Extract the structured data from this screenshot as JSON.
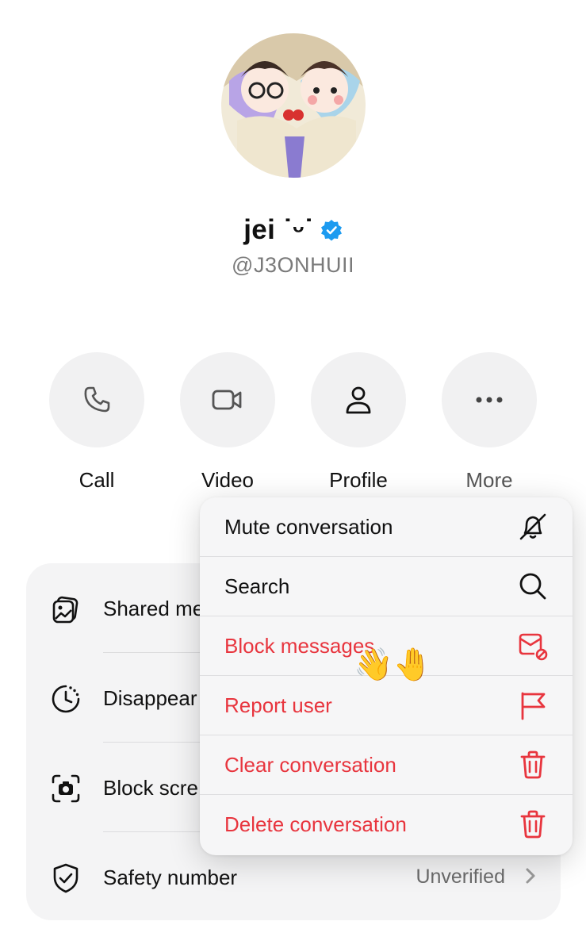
{
  "profile": {
    "display_name": "jei ˙ᵕ˙",
    "handle": "@J3ONHUII"
  },
  "actions": [
    {
      "label": "Call",
      "icon": "phone-icon"
    },
    {
      "label": "Video",
      "icon": "video-camera-icon"
    },
    {
      "label": "Profile",
      "icon": "person-icon"
    },
    {
      "label": "More",
      "icon": "more-dots-icon"
    }
  ],
  "settings": [
    {
      "label": "Shared me",
      "icon": "photos-icon"
    },
    {
      "label": "Disappear",
      "icon": "timer-icon"
    },
    {
      "label": "Block scre",
      "icon": "screenshot-camera-icon"
    },
    {
      "label": "Safety number",
      "icon": "shield-check-icon",
      "value": "Unverified"
    }
  ],
  "menu": [
    {
      "label": "Mute conversation",
      "icon": "bell-slash-icon",
      "danger": false
    },
    {
      "label": "Search",
      "icon": "search-icon",
      "danger": false
    },
    {
      "label": "Block messages",
      "icon": "envelope-block-icon",
      "danger": true
    },
    {
      "label": "Report user",
      "icon": "flag-icon",
      "danger": true
    },
    {
      "label": "Clear conversation",
      "icon": "trash-icon",
      "danger": true
    },
    {
      "label": "Delete conversation",
      "icon": "trash-icon",
      "danger": true
    }
  ],
  "overlay": {
    "emoji": "👋🤚"
  },
  "colors": {
    "danger": "#e8353e",
    "verified": "#1d9bf0",
    "card": "#f4f4f5"
  }
}
